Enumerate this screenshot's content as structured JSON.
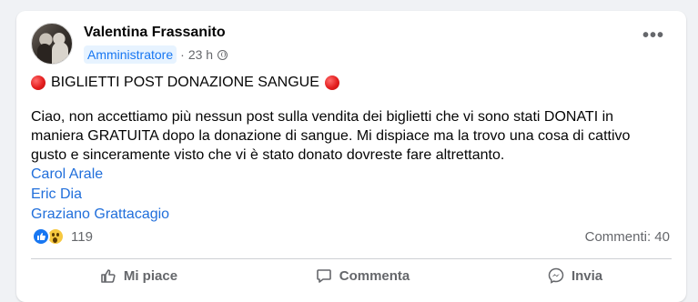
{
  "post": {
    "author": "Valentina Frassanito",
    "role_badge": "Amministratore",
    "time": "23 h",
    "separator": "·",
    "title": "BIGLIETTI POST DONAZIONE SANGUE",
    "body": "Ciao, non accettiamo più nessun post sulla vendita dei biglietti che vi sono stati DONATI in maniera GRATUITA dopo la donazione di sangue. Mi dispiace ma la trovo una cosa di cattivo gusto e sinceramente visto che vi è stato donato dovreste fare altrettanto.",
    "mentions": [
      "Carol Arale",
      "Eric Dia",
      "Graziano Grattacagio"
    ],
    "reaction_count": "119",
    "comments_label": "Commenti: 40",
    "more_label": "•••"
  },
  "actions": {
    "like": "Mi piace",
    "comment": "Commenta",
    "share": "Invia"
  },
  "icons": {
    "title_marker": "red-circle-icon",
    "privacy": "globe-icon",
    "reaction_1": "like-icon",
    "reaction_2": "wow-icon"
  },
  "colors": {
    "accent": "#1877f2",
    "mention": "#216fdb",
    "muted": "#65676b",
    "background": "#f0f2f5"
  }
}
